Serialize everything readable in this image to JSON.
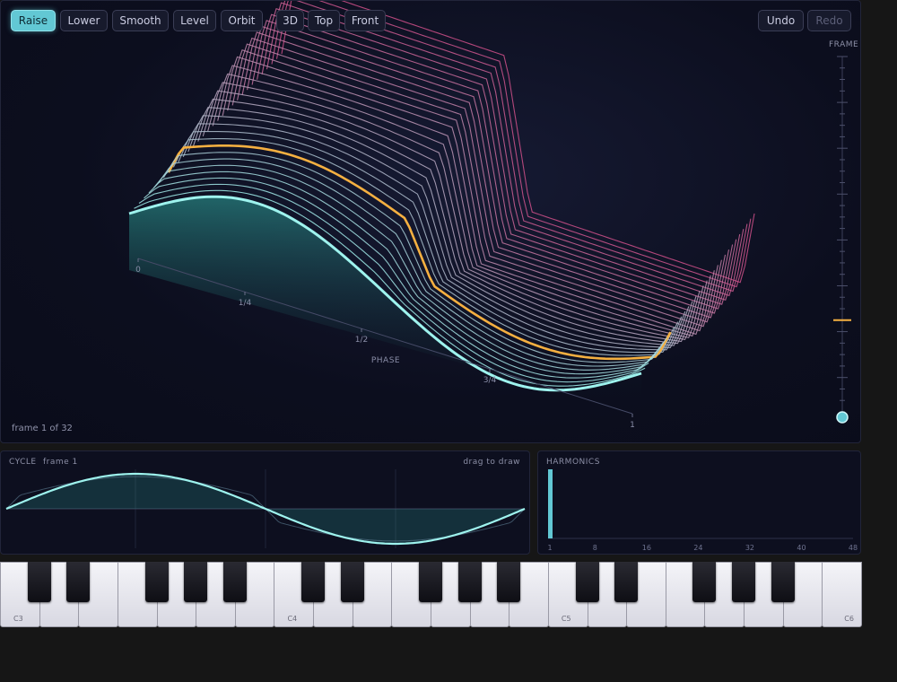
{
  "toolbar": {
    "edit_tools": [
      {
        "label": "Raise",
        "active": true
      },
      {
        "label": "Lower",
        "active": false
      },
      {
        "label": "Smooth",
        "active": false
      },
      {
        "label": "Level",
        "active": false
      },
      {
        "label": "Orbit",
        "active": false
      }
    ],
    "views": [
      {
        "label": "3D"
      },
      {
        "label": "Top"
      },
      {
        "label": "Front"
      }
    ],
    "undo_label": "Undo",
    "redo_label": "Redo",
    "redo_enabled": false
  },
  "viewer": {
    "phase_axis_label": "PHASE",
    "phase_ticks": [
      "0",
      "1/4",
      "1/2",
      "3/4",
      "1"
    ],
    "frame_status": "frame 1 of 32",
    "frame_count": 32,
    "current_frame": 1,
    "highlighted_frame": 9,
    "frame_slider_label": "FRAME"
  },
  "cycle": {
    "title": "CYCLE",
    "frame_label": "frame 1",
    "hint": "drag to draw"
  },
  "harmonics": {
    "title": "HARMONICS",
    "axis_labels": [
      "1",
      "8",
      "16",
      "24",
      "32",
      "40",
      "48"
    ],
    "levels": [
      1.0
    ]
  },
  "keyboard": {
    "octave_labels": [
      "C3",
      "C4",
      "C5",
      "C6"
    ]
  },
  "colors": {
    "accent": "#62c8d4",
    "highlight": "#f5b041",
    "wave_front": "#9ef3ee",
    "wave_back": "#d0508a"
  }
}
